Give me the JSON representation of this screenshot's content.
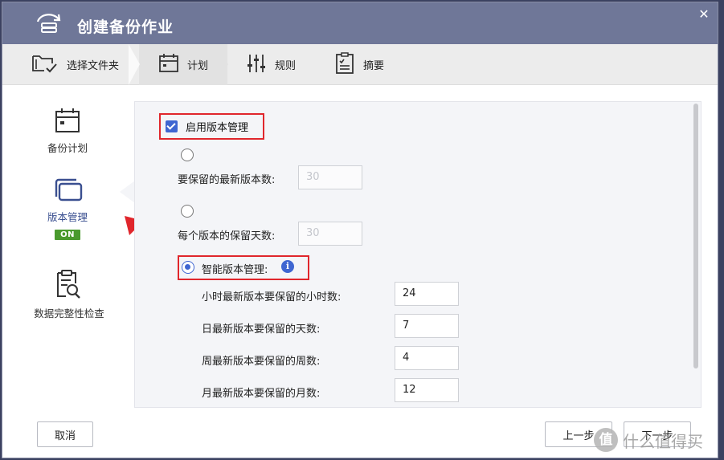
{
  "window": {
    "title": "创建备份作业",
    "close_label": "✕"
  },
  "steps": [
    {
      "label": "选择文件夹",
      "icon": "folder-check-icon"
    },
    {
      "label": "计划",
      "icon": "calendar-icon"
    },
    {
      "label": "规则",
      "icon": "sliders-icon"
    },
    {
      "label": "摘要",
      "icon": "clipboard-list-icon"
    }
  ],
  "sidebar": {
    "items": [
      {
        "label": "备份计划",
        "icon": "calendar-icon"
      },
      {
        "label": "版本管理",
        "icon": "versions-icon",
        "badge": "ON"
      },
      {
        "label": "数据完整性检查",
        "icon": "document-search-icon"
      }
    ]
  },
  "versioning": {
    "enable_label": "启用版本管理",
    "enabled": true,
    "option_count_label": "要保留的最新版本数:",
    "option_count_value": "30",
    "option_days_label": "每个版本的保留天数:",
    "option_days_value": "30",
    "smart_label": "智能版本管理:",
    "smart_info": "i",
    "selected_option": "smart",
    "smart_fields": [
      {
        "label": "小时最新版本要保留的小时数:",
        "value": "24"
      },
      {
        "label": "日最新版本要保留的天数:",
        "value": "7"
      },
      {
        "label": "周最新版本要保留的周数:",
        "value": "4"
      },
      {
        "label": "月最新版本要保留的月数:",
        "value": "12"
      }
    ]
  },
  "footer": {
    "cancel_label": "取消",
    "prev_label": "上一步",
    "next_label": "下一步"
  },
  "watermark": {
    "symbol": "值",
    "text": "什么值得买"
  },
  "colors": {
    "titlebar": "#6f7798",
    "accent": "#3f66d1",
    "highlight_red": "#e0262c",
    "on_badge": "#4a9a2e"
  }
}
